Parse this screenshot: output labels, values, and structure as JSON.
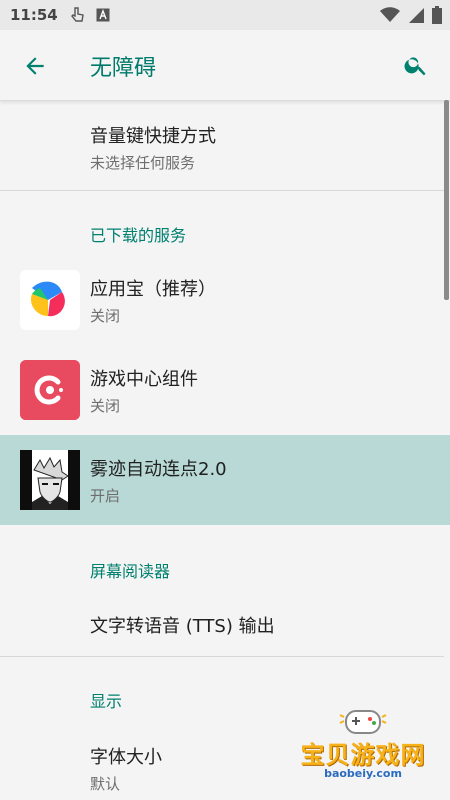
{
  "status": {
    "time": "11:54"
  },
  "appbar": {
    "title": "无障碍"
  },
  "volume_shortcut": {
    "title": "音量键快捷方式",
    "subtitle": "未选择任何服务"
  },
  "downloaded_section": {
    "header": "已下载的服务"
  },
  "services": [
    {
      "title": "应用宝（推荐）",
      "subtitle": "关闭"
    },
    {
      "title": "游戏中心组件",
      "subtitle": "关闭"
    },
    {
      "title": "雾迹自动连点2.0",
      "subtitle": "开启"
    }
  ],
  "screen_reader_section": {
    "header": "屏幕阅读器",
    "tts": "文字转语音 (TTS) 输出"
  },
  "display_section": {
    "header": "显示",
    "font_size": {
      "title": "字体大小",
      "subtitle": "默认"
    }
  },
  "watermark": {
    "text": "宝贝游戏网",
    "url": "baobeiy.com"
  },
  "colors": {
    "accent": "#00806e",
    "highlight": "#b8d9d5",
    "background": "#f4f4f4"
  }
}
